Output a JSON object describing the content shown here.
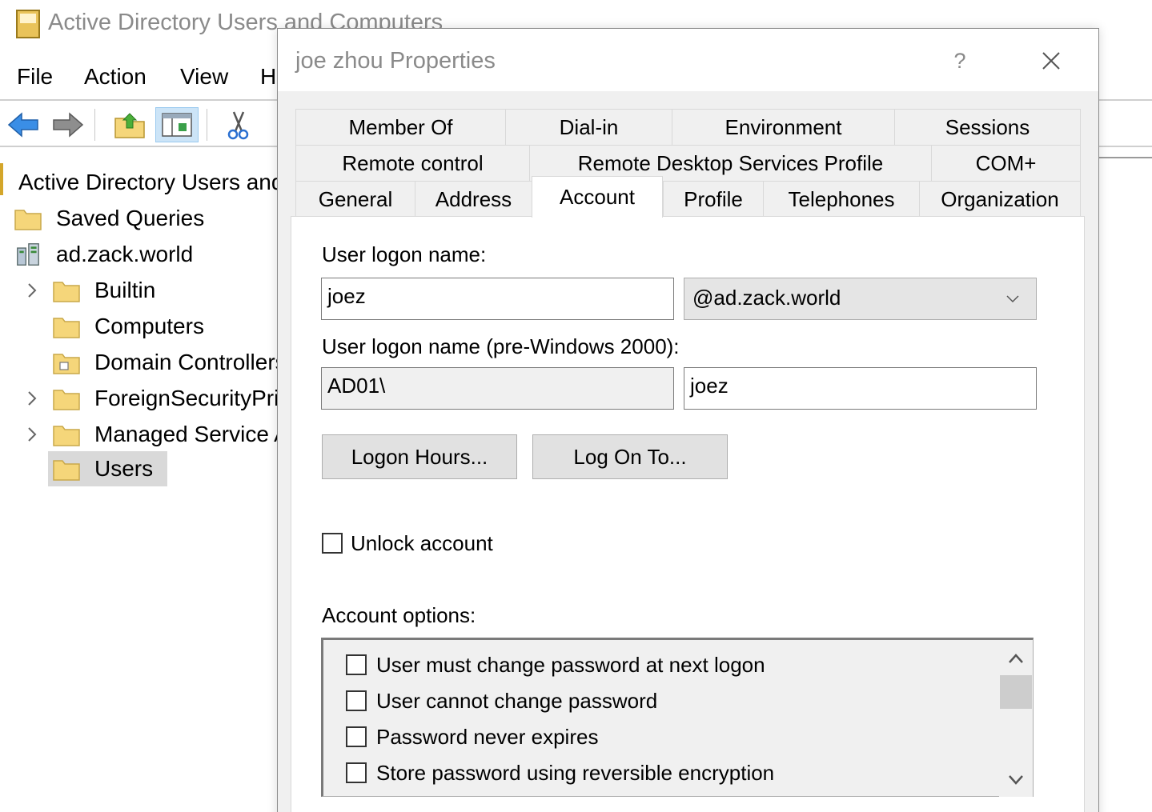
{
  "mmc": {
    "title": "Active Directory Users and Computers",
    "menu": [
      "File",
      "Action",
      "View",
      "Help"
    ],
    "toolbar": [
      {
        "icon": "back-arrow-icon"
      },
      {
        "icon": "forward-arrow-icon"
      },
      {
        "icon": "up-folder-icon"
      },
      {
        "icon": "show-hide-console-tree-icon",
        "active": true
      },
      {
        "icon": "cut-icon"
      },
      {
        "icon": "copy-icon"
      }
    ],
    "tree": {
      "root": "Active Directory Users and Computers",
      "items": [
        {
          "label": "Saved Queries",
          "level": 1,
          "expandable": false
        },
        {
          "label": "ad.zack.world",
          "level": 1,
          "expandable": false
        },
        {
          "label": "Builtin",
          "level": 2,
          "expandable": true
        },
        {
          "label": "Computers",
          "level": 2,
          "expandable": false
        },
        {
          "label": "Domain Controllers",
          "level": 2,
          "expandable": false
        },
        {
          "label": "ForeignSecurityPrincipals",
          "level": 2,
          "expandable": true
        },
        {
          "label": "Managed Service Accounts",
          "level": 2,
          "expandable": true
        },
        {
          "label": "Users",
          "level": 2,
          "expandable": false,
          "selected": true
        }
      ]
    }
  },
  "dialog": {
    "title": "joe zhou Properties",
    "help_label": "?",
    "tabs": {
      "row1": [
        "Member Of",
        "Dial-in",
        "Environment",
        "Sessions"
      ],
      "row2": [
        "Remote control",
        "Remote Desktop Services Profile",
        "COM+"
      ],
      "row3": [
        "General",
        "Address",
        "Account",
        "Profile",
        "Telephones",
        "Organization"
      ],
      "selected": "Account"
    },
    "account": {
      "logon_name_label": "User logon name:",
      "logon_name_value": "joez",
      "upn_suffix": "@ad.zack.world",
      "pre2000_label": "User logon name (pre-Windows 2000):",
      "pre2000_domain": "AD01\\",
      "pre2000_name": "joez",
      "logon_hours_button": "Logon Hours...",
      "log_on_to_button": "Log On To...",
      "unlock_label": "Unlock account",
      "unlock_checked": false,
      "options_label": "Account options:",
      "options": [
        {
          "label": "User must change password at next logon",
          "checked": false
        },
        {
          "label": "User cannot change password",
          "checked": false
        },
        {
          "label": "Password never expires",
          "checked": false
        },
        {
          "label": "Store password using reversible encryption",
          "checked": false
        }
      ]
    }
  },
  "colors": {
    "dialog_bg": "#f0f0f0",
    "tab_selected_bg": "#ffffff",
    "tree_selection": "#d9d9d9",
    "toolbar_active": "#cce4f7",
    "folder_yellow": "#f5d67a"
  }
}
